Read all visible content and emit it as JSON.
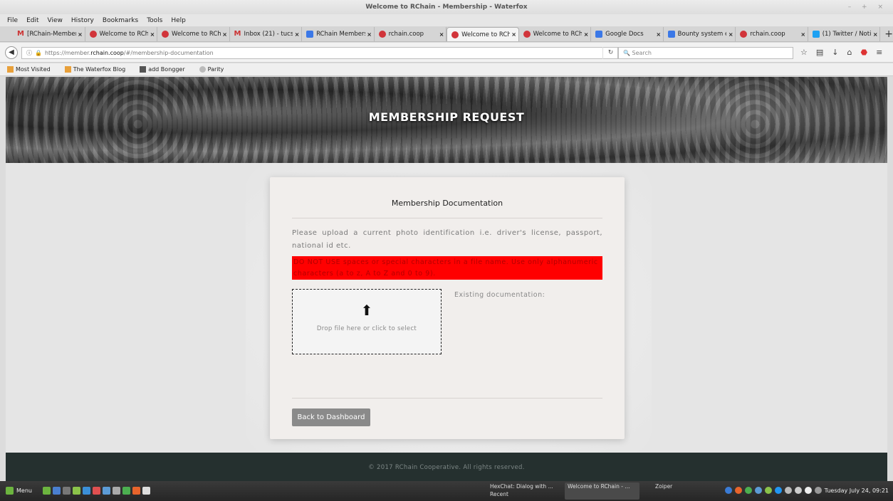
{
  "window": {
    "title": "Welcome to RChain - Membership - Waterfox",
    "controls": "– + ×"
  },
  "menubar": [
    "File",
    "Edit",
    "View",
    "History",
    "Bookmarks",
    "Tools",
    "Help"
  ],
  "tabs": [
    {
      "label": "[RChain-Member",
      "icon": "gmail-icon"
    },
    {
      "label": "Welcome to RCh",
      "icon": "rchain-icon"
    },
    {
      "label": "Welcome to RCh",
      "icon": "rchain-icon"
    },
    {
      "label": "Inbox (21) - tucso",
      "icon": "gmail-icon"
    },
    {
      "label": "RChain Members",
      "icon": "docs-icon"
    },
    {
      "label": "rchain.coop",
      "icon": "rchain-icon"
    },
    {
      "label": "Welcome to RCh",
      "icon": "rchain-icon",
      "active": true
    },
    {
      "label": "Welcome to RCh",
      "icon": "rchain-icon"
    },
    {
      "label": "Google Docs",
      "icon": "docs-icon"
    },
    {
      "label": "Bounty system e",
      "icon": "docs-icon"
    },
    {
      "label": "rchain.coop",
      "icon": "rchain-icon"
    },
    {
      "label": "(1) Twitter / Notif",
      "icon": "twitter-icon"
    }
  ],
  "nav": {
    "url_prefix": "https://member.",
    "url_domain": "rchain.coop",
    "url_path": "/#/membership-documentation",
    "search_placeholder": "Search"
  },
  "bookmarks": [
    "Most Visited",
    "The Waterfox Blog",
    "add Bongger",
    "Parity"
  ],
  "hero": {
    "title": "MEMBERSHIP REQUEST"
  },
  "card": {
    "title": "Membership Documentation",
    "instructions": "Please upload a current photo identification i.e. driver's license, passport, national id etc.",
    "warning": "DO NOT USE spaces or special characters in a file name. Use only alphanumeric characters (a to z, A to Z and 0 to 9).",
    "dropzone_text": "Drop file here or click to select",
    "existing_label": "Existing documentation:",
    "back_button": "Back to Dashboard"
  },
  "footer": {
    "text": "© 2017 RChain Cooperative. All rights reserved."
  },
  "taskbar": {
    "menu_label": "Menu",
    "tasks": [
      {
        "line1": "HexChat: Dialog with ...",
        "line2": "Recent"
      },
      {
        "line1": "Welcome to RChain - ...",
        "line2": ""
      },
      {
        "line1": "Zoiper",
        "line2": ""
      }
    ],
    "clock": "Tuesday July 24, 09:21"
  },
  "colors": {
    "warning_bg": "#ff0000",
    "footer_bg": "#25302f",
    "button_bg": "#8a8a8a"
  }
}
